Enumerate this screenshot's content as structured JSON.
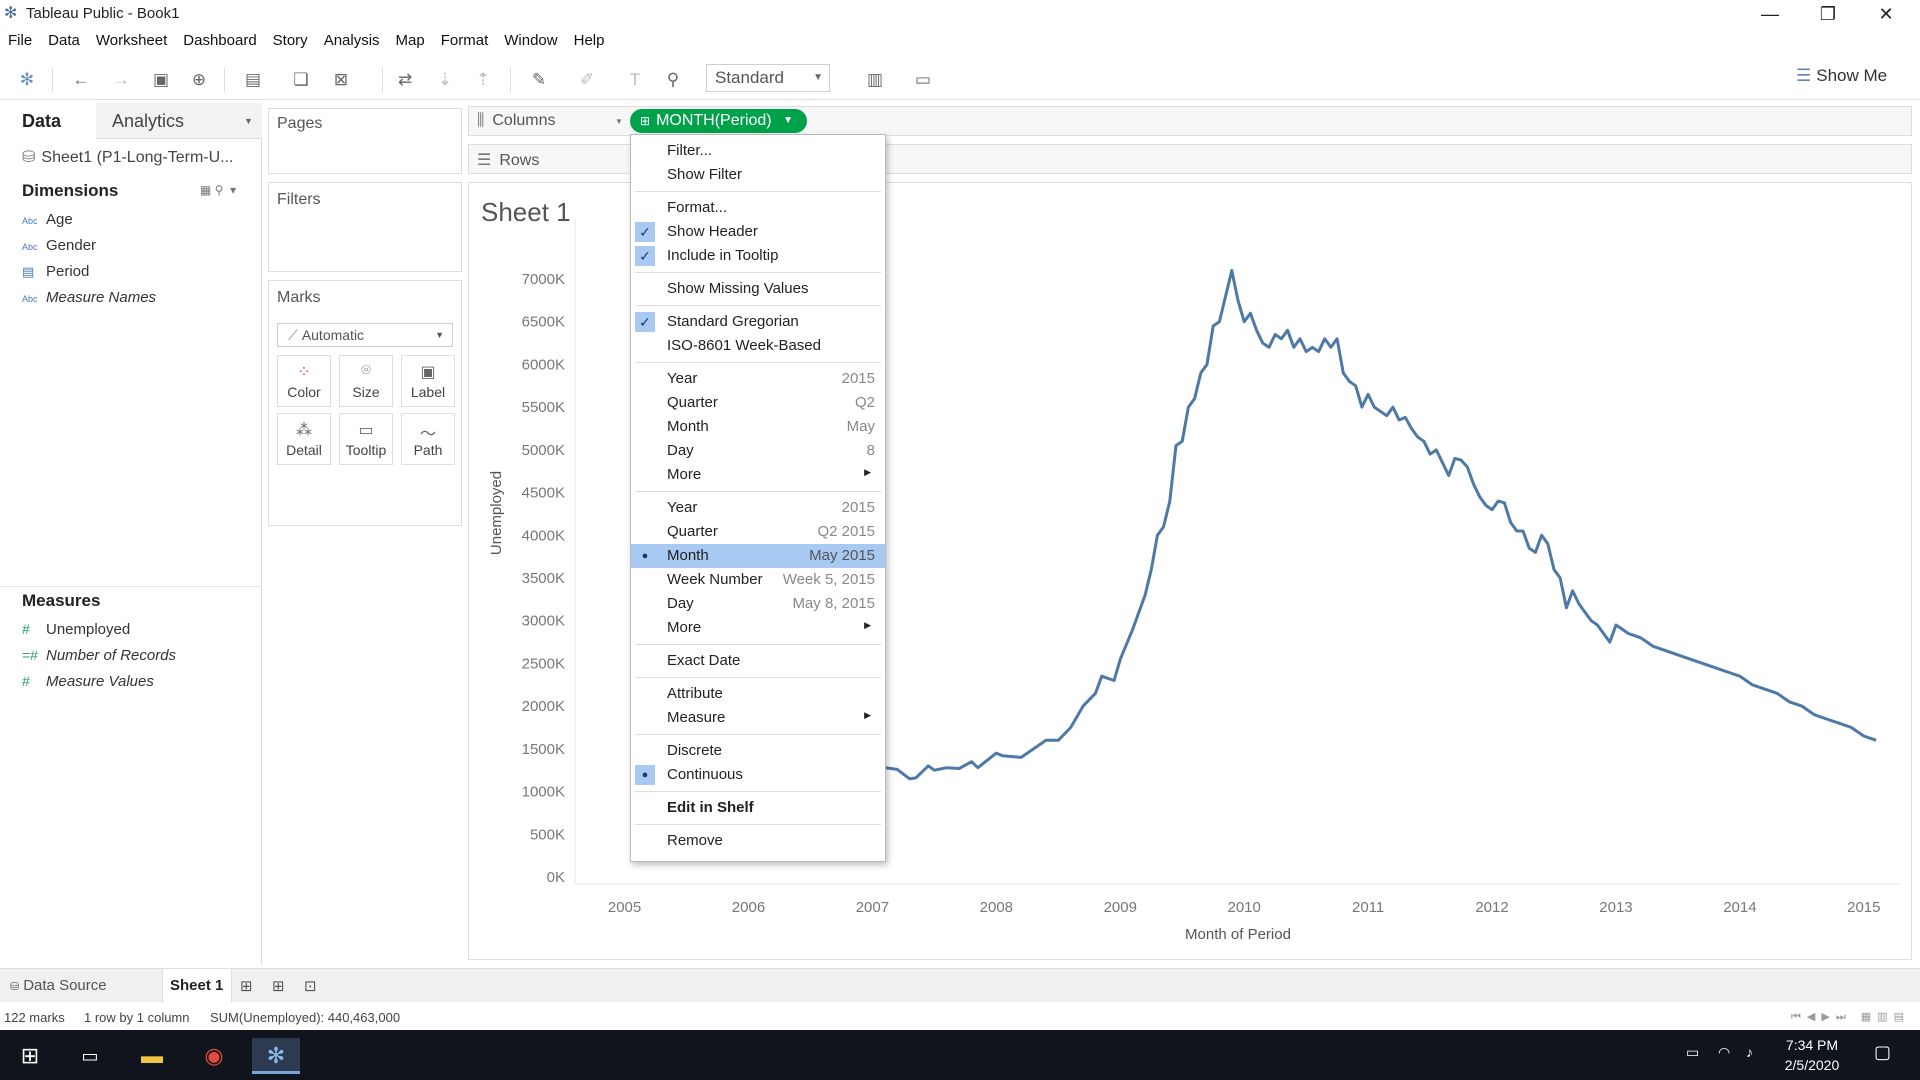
{
  "window": {
    "title": "Tableau Public - Book1"
  },
  "menu": [
    "File",
    "Data",
    "Worksheet",
    "Dashboard",
    "Story",
    "Analysis",
    "Map",
    "Format",
    "Window",
    "Help"
  ],
  "toolbar": {
    "fit_value": "Standard",
    "show_me_label": "Show Me"
  },
  "data_pane": {
    "tab_data": "Data",
    "tab_analytics": "Analytics",
    "datasource": "Sheet1 (P1-Long-Term-U...",
    "dimensions_title": "Dimensions",
    "dimensions": [
      {
        "icon": "Abc",
        "name": "Age"
      },
      {
        "icon": "Abc",
        "name": "Gender"
      },
      {
        "icon": "date",
        "name": "Period"
      },
      {
        "icon": "Abc",
        "name": "Measure Names"
      }
    ],
    "measures_title": "Measures",
    "measures": [
      {
        "icon": "#",
        "name": "Unemployed"
      },
      {
        "icon": "=#",
        "name": "Number of Records"
      },
      {
        "icon": "#",
        "name": "Measure Values"
      }
    ]
  },
  "cards": {
    "pages": "Pages",
    "filters": "Filters",
    "marks": "Marks",
    "mark_type": "Automatic",
    "mark_buttons": [
      "Color",
      "Size",
      "Label",
      "Detail",
      "Tooltip",
      "Path"
    ]
  },
  "shelves": {
    "columns": "Columns",
    "rows": "Rows",
    "column_pill": "MONTH(Period)"
  },
  "sheet": {
    "title": "Sheet 1"
  },
  "context_menu": {
    "items": [
      {
        "label": "Filter..."
      },
      {
        "label": "Show Filter"
      },
      {
        "label": "Format..."
      },
      {
        "label": "Show Header",
        "checked": true
      },
      {
        "label": "Include in Tooltip",
        "checked": true
      },
      {
        "label": "Show Missing Values"
      },
      {
        "label": "Standard Gregorian",
        "checked": true
      },
      {
        "label": "ISO-8601 Week-Based"
      },
      {
        "label": "Year",
        "value": "2015"
      },
      {
        "label": "Quarter",
        "value": "Q2"
      },
      {
        "label": "Month",
        "value": "May"
      },
      {
        "label": "Day",
        "value": "8"
      },
      {
        "label": "More",
        "submenu": true
      },
      {
        "label": "Year",
        "value": "2015"
      },
      {
        "label": "Quarter",
        "value": "Q2 2015"
      },
      {
        "label": "Month",
        "value": "May 2015",
        "selected": true,
        "highlight": true
      },
      {
        "label": "Week Number",
        "value": "Week 5, 2015"
      },
      {
        "label": "Day",
        "value": "May 8, 2015"
      },
      {
        "label": "More",
        "submenu": true
      },
      {
        "label": "Exact Date"
      },
      {
        "label": "Attribute"
      },
      {
        "label": "Measure",
        "submenu": true
      },
      {
        "label": "Discrete"
      },
      {
        "label": "Continuous",
        "selected": true
      },
      {
        "label": "Edit in Shelf",
        "bold": true
      },
      {
        "label": "Remove"
      }
    ]
  },
  "chart_data": {
    "type": "line",
    "title": "Sheet 1",
    "xlabel": "Month of Period",
    "ylabel": "Unemployed",
    "x_ticks": [
      "2005",
      "2006",
      "2007",
      "2008",
      "2009",
      "2010",
      "2011",
      "2012",
      "2013",
      "2014",
      "2015"
    ],
    "y_ticks": [
      "0K",
      "500K",
      "1000K",
      "1500K",
      "2000K",
      "2500K",
      "3000K",
      "3500K",
      "4000K",
      "4500K",
      "5000K",
      "5500K",
      "6000K",
      "6500K",
      "7000K"
    ],
    "ylim": [
      0,
      7000
    ],
    "xlim": [
      2004.6,
      2015.3
    ],
    "color": "#4e79a7",
    "series": [
      {
        "x": [
          2007.0,
          2007.1,
          2007.2,
          2007.3,
          2007.35,
          2007.45,
          2007.5,
          2007.6,
          2007.7,
          2007.8,
          2007.85,
          2008.0,
          2008.05,
          2008.2,
          2008.3,
          2008.4,
          2008.5,
          2008.6,
          2008.7,
          2008.8,
          2008.85,
          2008.95,
          2009.0,
          2009.1,
          2009.2,
          2009.25,
          2009.3,
          2009.35,
          2009.4,
          2009.45,
          2009.5,
          2009.55,
          2009.6,
          2009.65,
          2009.7,
          2009.75,
          2009.8,
          2009.85,
          2009.9,
          2009.95,
          2010.0,
          2010.05,
          2010.1,
          2010.15,
          2010.2,
          2010.25,
          2010.3,
          2010.35,
          2010.4,
          2010.45,
          2010.5,
          2010.55,
          2010.6,
          2010.65,
          2010.7,
          2010.75,
          2010.8,
          2010.85,
          2010.9,
          2010.95,
          2011.0,
          2011.05,
          2011.1,
          2011.15,
          2011.2,
          2011.25,
          2011.3,
          2011.35,
          2011.4,
          2011.45,
          2011.5,
          2011.55,
          2011.6,
          2011.65,
          2011.7,
          2011.75,
          2011.8,
          2011.85,
          2011.9,
          2011.95,
          2012.0,
          2012.05,
          2012.1,
          2012.15,
          2012.2,
          2012.25,
          2012.3,
          2012.35,
          2012.4,
          2012.45,
          2012.5,
          2012.55,
          2012.6,
          2012.65,
          2012.7,
          2012.75,
          2012.8,
          2012.85,
          2012.9,
          2012.95,
          2013.0,
          2013.1,
          2013.2,
          2013.3,
          2013.4,
          2013.5,
          2013.6,
          2013.7,
          2013.8,
          2013.9,
          2014.0,
          2014.05,
          2014.1,
          2014.2,
          2014.3,
          2014.35,
          2014.4,
          2014.5,
          2014.55,
          2014.6,
          2014.7,
          2014.8,
          2014.9,
          2014.95,
          2015.0,
          2015.1
        ],
        "values": [
          1260,
          1280,
          1260,
          1150,
          1160,
          1300,
          1250,
          1280,
          1270,
          1350,
          1280,
          1450,
          1420,
          1400,
          1500,
          1600,
          1600,
          1750,
          2000,
          2150,
          2350,
          2300,
          2550,
          2900,
          3300,
          3600,
          4000,
          4100,
          4400,
          5050,
          5100,
          5500,
          5600,
          5900,
          6000,
          6450,
          6500,
          6800,
          7100,
          6750,
          6500,
          6600,
          6400,
          6250,
          6200,
          6350,
          6300,
          6400,
          6200,
          6300,
          6150,
          6200,
          6150,
          6300,
          6200,
          6300,
          5900,
          5800,
          5750,
          5500,
          5650,
          5500,
          5450,
          5400,
          5500,
          5350,
          5380,
          5250,
          5150,
          5100,
          4950,
          5000,
          4850,
          4700,
          4900,
          4880,
          4800,
          4600,
          4450,
          4350,
          4300,
          4400,
          4380,
          4150,
          4050,
          4050,
          3850,
          3800,
          4000,
          3900,
          3600,
          3500,
          3150,
          3350,
          3200,
          3100,
          3000,
          2950,
          2850,
          2750,
          2950,
          2850,
          2800,
          2700,
          2650,
          2600,
          2550,
          2500,
          2450,
          2400,
          2350,
          2300,
          2250,
          2200,
          2150,
          2100,
          2050,
          2000,
          1950,
          1900,
          1850,
          1800,
          1750,
          1700,
          1650,
          1600
        ]
      }
    ]
  },
  "tabs_bottom": {
    "data_source": "Data Source",
    "sheet1": "Sheet 1"
  },
  "status": {
    "marks": "122 marks",
    "rows_cols": "1 row by 1 column",
    "sum": "SUM(Unemployed): 440,463,000"
  },
  "taskbar": {
    "time": "7:34 PM",
    "date": "2/5/2020"
  }
}
